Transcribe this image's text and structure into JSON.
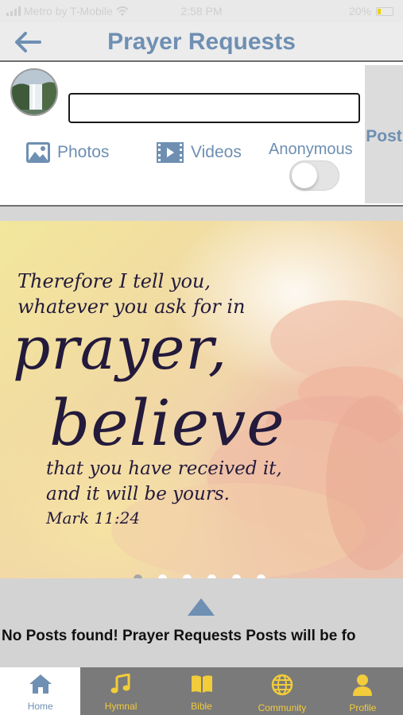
{
  "status_bar": {
    "carrier": "Metro by T-Mobile",
    "time": "2:58 PM",
    "battery": "20%"
  },
  "header": {
    "title": "Prayer Requests",
    "back_icon": "back-arrow-icon"
  },
  "composer": {
    "input_value": "",
    "photos_label": "Photos",
    "videos_label": "Videos",
    "anonymous_label": "Anonymous",
    "anonymous_on": false,
    "post_label": "Post"
  },
  "carousel": {
    "line1": "Therefore I tell you,",
    "line2": "whatever you ask for in",
    "word1": "prayer,",
    "word2": "believe",
    "line3": "that you have received it,",
    "line4": "and it will be yours.",
    "reference": "Mark 11:24",
    "slide_count": 6,
    "active_slide": 0
  },
  "feed": {
    "empty_message": "No Posts found! Prayer Requests Posts will be fo"
  },
  "tab_bar": {
    "items": [
      {
        "label": "Home",
        "icon": "home-icon",
        "active": true
      },
      {
        "label": "Hymnal",
        "icon": "music-note-icon",
        "active": false
      },
      {
        "label": "Bible",
        "icon": "book-icon",
        "active": false
      },
      {
        "label": "Community",
        "icon": "globe-icon",
        "active": false
      },
      {
        "label": "Profile",
        "icon": "person-icon",
        "active": false
      }
    ]
  },
  "colors": {
    "accent_blue": "#6f8fb3",
    "tab_bar_bg": "#7a7a7a",
    "tab_icon_yellow": "#f2cc3a"
  }
}
